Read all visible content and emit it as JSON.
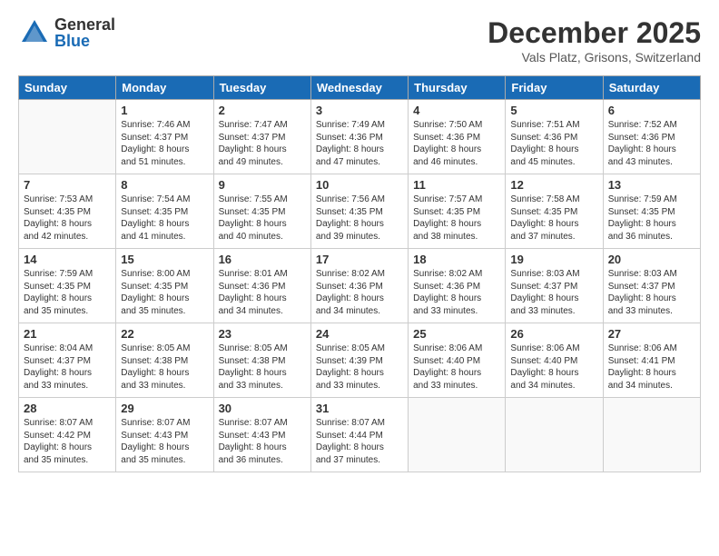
{
  "header": {
    "logo_general": "General",
    "logo_blue": "Blue",
    "month_year": "December 2025",
    "location": "Vals Platz, Grisons, Switzerland"
  },
  "weekdays": [
    "Sunday",
    "Monday",
    "Tuesday",
    "Wednesday",
    "Thursday",
    "Friday",
    "Saturday"
  ],
  "weeks": [
    [
      {
        "day": "",
        "info": ""
      },
      {
        "day": "1",
        "info": "Sunrise: 7:46 AM\nSunset: 4:37 PM\nDaylight: 8 hours\nand 51 minutes."
      },
      {
        "day": "2",
        "info": "Sunrise: 7:47 AM\nSunset: 4:37 PM\nDaylight: 8 hours\nand 49 minutes."
      },
      {
        "day": "3",
        "info": "Sunrise: 7:49 AM\nSunset: 4:36 PM\nDaylight: 8 hours\nand 47 minutes."
      },
      {
        "day": "4",
        "info": "Sunrise: 7:50 AM\nSunset: 4:36 PM\nDaylight: 8 hours\nand 46 minutes."
      },
      {
        "day": "5",
        "info": "Sunrise: 7:51 AM\nSunset: 4:36 PM\nDaylight: 8 hours\nand 45 minutes."
      },
      {
        "day": "6",
        "info": "Sunrise: 7:52 AM\nSunset: 4:36 PM\nDaylight: 8 hours\nand 43 minutes."
      }
    ],
    [
      {
        "day": "7",
        "info": "Sunrise: 7:53 AM\nSunset: 4:35 PM\nDaylight: 8 hours\nand 42 minutes."
      },
      {
        "day": "8",
        "info": "Sunrise: 7:54 AM\nSunset: 4:35 PM\nDaylight: 8 hours\nand 41 minutes."
      },
      {
        "day": "9",
        "info": "Sunrise: 7:55 AM\nSunset: 4:35 PM\nDaylight: 8 hours\nand 40 minutes."
      },
      {
        "day": "10",
        "info": "Sunrise: 7:56 AM\nSunset: 4:35 PM\nDaylight: 8 hours\nand 39 minutes."
      },
      {
        "day": "11",
        "info": "Sunrise: 7:57 AM\nSunset: 4:35 PM\nDaylight: 8 hours\nand 38 minutes."
      },
      {
        "day": "12",
        "info": "Sunrise: 7:58 AM\nSunset: 4:35 PM\nDaylight: 8 hours\nand 37 minutes."
      },
      {
        "day": "13",
        "info": "Sunrise: 7:59 AM\nSunset: 4:35 PM\nDaylight: 8 hours\nand 36 minutes."
      }
    ],
    [
      {
        "day": "14",
        "info": "Sunrise: 7:59 AM\nSunset: 4:35 PM\nDaylight: 8 hours\nand 35 minutes."
      },
      {
        "day": "15",
        "info": "Sunrise: 8:00 AM\nSunset: 4:35 PM\nDaylight: 8 hours\nand 35 minutes."
      },
      {
        "day": "16",
        "info": "Sunrise: 8:01 AM\nSunset: 4:36 PM\nDaylight: 8 hours\nand 34 minutes."
      },
      {
        "day": "17",
        "info": "Sunrise: 8:02 AM\nSunset: 4:36 PM\nDaylight: 8 hours\nand 34 minutes."
      },
      {
        "day": "18",
        "info": "Sunrise: 8:02 AM\nSunset: 4:36 PM\nDaylight: 8 hours\nand 33 minutes."
      },
      {
        "day": "19",
        "info": "Sunrise: 8:03 AM\nSunset: 4:37 PM\nDaylight: 8 hours\nand 33 minutes."
      },
      {
        "day": "20",
        "info": "Sunrise: 8:03 AM\nSunset: 4:37 PM\nDaylight: 8 hours\nand 33 minutes."
      }
    ],
    [
      {
        "day": "21",
        "info": "Sunrise: 8:04 AM\nSunset: 4:37 PM\nDaylight: 8 hours\nand 33 minutes."
      },
      {
        "day": "22",
        "info": "Sunrise: 8:05 AM\nSunset: 4:38 PM\nDaylight: 8 hours\nand 33 minutes."
      },
      {
        "day": "23",
        "info": "Sunrise: 8:05 AM\nSunset: 4:38 PM\nDaylight: 8 hours\nand 33 minutes."
      },
      {
        "day": "24",
        "info": "Sunrise: 8:05 AM\nSunset: 4:39 PM\nDaylight: 8 hours\nand 33 minutes."
      },
      {
        "day": "25",
        "info": "Sunrise: 8:06 AM\nSunset: 4:40 PM\nDaylight: 8 hours\nand 33 minutes."
      },
      {
        "day": "26",
        "info": "Sunrise: 8:06 AM\nSunset: 4:40 PM\nDaylight: 8 hours\nand 34 minutes."
      },
      {
        "day": "27",
        "info": "Sunrise: 8:06 AM\nSunset: 4:41 PM\nDaylight: 8 hours\nand 34 minutes."
      }
    ],
    [
      {
        "day": "28",
        "info": "Sunrise: 8:07 AM\nSunset: 4:42 PM\nDaylight: 8 hours\nand 35 minutes."
      },
      {
        "day": "29",
        "info": "Sunrise: 8:07 AM\nSunset: 4:43 PM\nDaylight: 8 hours\nand 35 minutes."
      },
      {
        "day": "30",
        "info": "Sunrise: 8:07 AM\nSunset: 4:43 PM\nDaylight: 8 hours\nand 36 minutes."
      },
      {
        "day": "31",
        "info": "Sunrise: 8:07 AM\nSunset: 4:44 PM\nDaylight: 8 hours\nand 37 minutes."
      },
      {
        "day": "",
        "info": ""
      },
      {
        "day": "",
        "info": ""
      },
      {
        "day": "",
        "info": ""
      }
    ]
  ]
}
